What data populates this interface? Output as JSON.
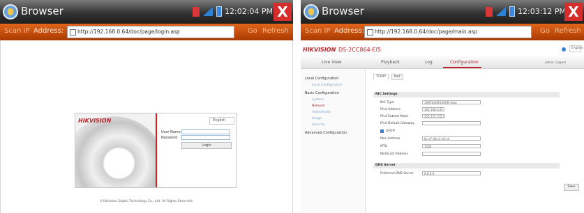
{
  "left": {
    "window_title": "Browser",
    "time": "12:02:04 PM",
    "close_label": "X",
    "scan_ip_label": "Scan IP",
    "address_label": "Address:",
    "url": "http://192.168.0.64/doc/page/login.asp",
    "go_label": "Go",
    "refresh_label": "Refresh",
    "login": {
      "brand": "HIKVISION",
      "language": "English",
      "username_label": "User Name",
      "password_label": "Password",
      "login_button": "Login",
      "copyright": "©Hikvision Digital Technology Co., Ltd. All Rights Reserved."
    }
  },
  "right": {
    "window_title": "Browser",
    "time": "12:03:12 PM",
    "close_label": "X",
    "scan_ip_label": "Scan IP",
    "address_label": "Address:",
    "url": "http://192.168.0.64/doc/page/main.asp",
    "go_label": "Go",
    "refresh_label": "Refresh",
    "brand": "HIKVISION",
    "device": "DS-2CC864-EI5",
    "language": "English",
    "user": "admin | Logout",
    "nav": [
      "Live View",
      "Playback",
      "Log",
      "Configuration"
    ],
    "sidebar": {
      "local": "Local Configuration",
      "local_sub": "Local Configuration",
      "basic": "Basic Configuration",
      "items": [
        "System",
        "Network",
        "Video/Audio",
        "Image",
        "Security"
      ],
      "advanced": "Advanced Configuration"
    },
    "tabs": [
      "TCP/IP",
      "Port"
    ],
    "nic_title": "NIC Settings",
    "fields": [
      {
        "label": "NIC Type",
        "value": "10M/100M/1000M Auto"
      },
      {
        "label": "IPv4 Address",
        "value": "192.168.0.64"
      },
      {
        "label": "IPv4 Subnet Mask",
        "value": "255.255.255.0"
      },
      {
        "label": "IPv4 Default Gateway",
        "value": ""
      }
    ],
    "dhcp_label": "DHCP",
    "fields2": [
      {
        "label": "Mac Address",
        "value": "8c:e7:48:c2:e0:e4"
      },
      {
        "label": "MTU",
        "value": "1500"
      },
      {
        "label": "Multicast Address",
        "value": ""
      }
    ],
    "dns_title": "DNS Server",
    "dns_label": "Preferred DNS Server",
    "dns_value": "8.8.8.8",
    "save_label": "Save"
  }
}
